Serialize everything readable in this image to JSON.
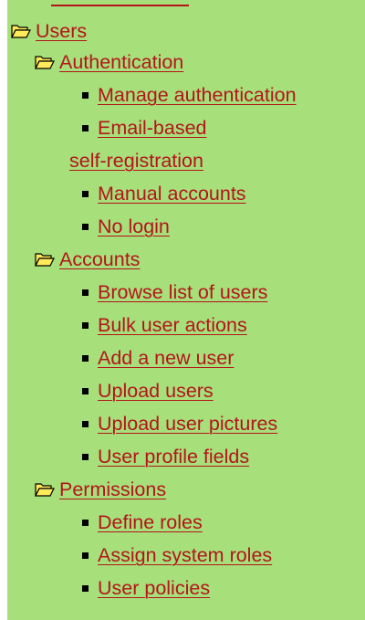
{
  "menu": {
    "users": {
      "label": "Users",
      "authentication": {
        "label": "Authentication",
        "items": [
          {
            "label": "Manage authentication"
          },
          {
            "label_line1": "Email-based",
            "label_line2": "self-registration"
          },
          {
            "label": "Manual accounts"
          },
          {
            "label": "No login"
          }
        ]
      },
      "accounts": {
        "label": "Accounts",
        "items": [
          {
            "label": "Browse list of users"
          },
          {
            "label": "Bulk user actions"
          },
          {
            "label": "Add a new user"
          },
          {
            "label": "Upload users"
          },
          {
            "label": "Upload user pictures"
          },
          {
            "label": "User profile fields"
          }
        ]
      },
      "permissions": {
        "label": "Permissions",
        "items": [
          {
            "label": "Define roles"
          },
          {
            "label": "Assign system roles"
          },
          {
            "label": "User policies"
          }
        ]
      }
    }
  },
  "colors": {
    "panel_background": "#a7df7a",
    "link": "#b3151b",
    "bullet": "#000000",
    "folder_fill": "#ffea5a"
  },
  "icons": {
    "folder": "open-folder-icon",
    "bullet": "square-bullet"
  }
}
